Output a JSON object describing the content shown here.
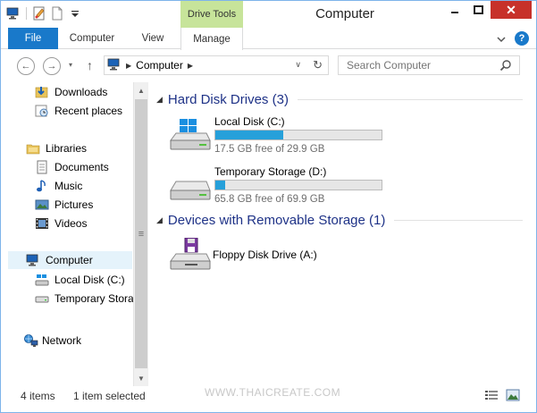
{
  "window": {
    "title": "Computer",
    "contextual_tab_group": "Drive Tools",
    "close_glyph": "✕",
    "minimize_glyph": "─",
    "maximize_glyph": "□"
  },
  "ribbon": {
    "tabs": [
      {
        "label": "File",
        "active": true
      },
      {
        "label": "Computer"
      },
      {
        "label": "View"
      },
      {
        "label": "Manage"
      }
    ],
    "help_glyph": "?",
    "expand_glyph": "⌄"
  },
  "navbar": {
    "back_glyph": "←",
    "forward_glyph": "→",
    "recent_glyph": "▾",
    "up_glyph": "↑",
    "breadcrumb": [
      "Computer"
    ],
    "dropdown_glyph": "∨",
    "refresh_glyph": "↻",
    "search_placeholder": "Search Computer"
  },
  "nav_pane": {
    "favorites": [
      {
        "label": "Downloads",
        "icon": "downloads-icon"
      },
      {
        "label": "Recent places",
        "icon": "recent-places-icon"
      }
    ],
    "libraries": {
      "label": "Libraries",
      "icon": "libraries-icon",
      "items": [
        {
          "label": "Documents",
          "icon": "documents-icon"
        },
        {
          "label": "Music",
          "icon": "music-icon"
        },
        {
          "label": "Pictures",
          "icon": "pictures-icon"
        },
        {
          "label": "Videos",
          "icon": "videos-icon"
        }
      ]
    },
    "computer": {
      "label": "Computer",
      "icon": "computer-icon",
      "selected": true,
      "items": [
        {
          "label": "Local Disk (C:)",
          "icon": "local-disk-icon"
        },
        {
          "label": "Temporary Stora",
          "icon": "drive-icon"
        }
      ]
    },
    "network": {
      "label": "Network",
      "icon": "network-icon"
    },
    "scroll_up_glyph": "▲",
    "scroll_down_glyph": "▼",
    "thumb_grip_glyph": "≡"
  },
  "content": {
    "groups": [
      {
        "title": "Hard Disk Drives (3)",
        "drives": [
          {
            "name": "Local Disk (C:)",
            "free_text": "17.5 GB free of 29.9 GB",
            "used_fraction": 0.41,
            "icon": "windows-drive-icon"
          },
          {
            "name": "Temporary Storage (D:)",
            "free_text": "65.8 GB free of 69.9 GB",
            "used_fraction": 0.06,
            "icon": "hard-drive-icon"
          }
        ]
      },
      {
        "title": "Devices with Removable Storage (1)",
        "drives": [
          {
            "name": "Floppy Disk Drive (A:)",
            "icon": "floppy-drive-icon"
          }
        ]
      }
    ],
    "collapse_glyph": "◢",
    "bar_color": "#26a0da"
  },
  "status": {
    "item_count": "4 items",
    "selected": "1 item selected",
    "watermark": "WWW.THAICREATE.COM"
  },
  "colors": {
    "accent": "#1979ca",
    "contextual": "#c7e49a",
    "close": "#c7312a",
    "group_title": "#1e3287"
  }
}
